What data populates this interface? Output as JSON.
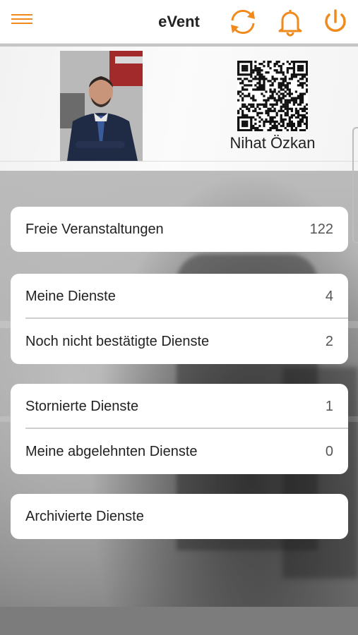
{
  "header": {
    "title": "eVent",
    "accent_color": "#f08a1c",
    "icons": [
      "menu-icon",
      "sync-icon",
      "bell-icon",
      "power-icon"
    ]
  },
  "profile": {
    "name": "Nihat Özkan"
  },
  "cards": [
    {
      "rows": [
        {
          "label": "Freie Veranstaltungen",
          "count": "122"
        }
      ]
    },
    {
      "rows": [
        {
          "label": "Meine Dienste",
          "count": "4"
        },
        {
          "label": "Noch nicht bestätigte Dienste",
          "count": "2"
        }
      ]
    },
    {
      "rows": [
        {
          "label": "Stornierte Dienste",
          "count": "1"
        },
        {
          "label": "Meine abgelehnten Dienste",
          "count": "0"
        }
      ]
    },
    {
      "rows": [
        {
          "label": "Archivierte Dienste",
          "count": ""
        }
      ]
    }
  ]
}
